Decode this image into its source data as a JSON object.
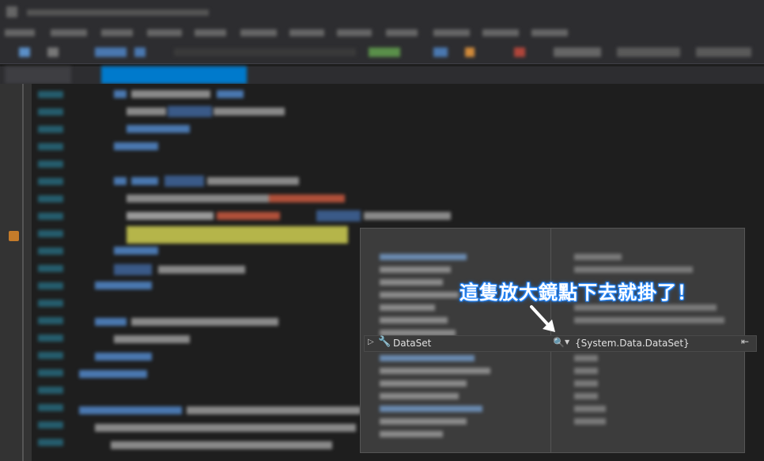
{
  "datatip": {
    "variable_name": "DataSet",
    "variable_value": "{System.Data.DataSet}",
    "wrench_icon": "wrench-icon",
    "magnifier_icon": "magnifier-icon",
    "expand_icon": "expand-triangle-icon",
    "pin_icon": "pin-icon"
  },
  "annotation": {
    "text": "這隻放大鏡點下去就掛了！",
    "color": "#ffffff",
    "glow": "#1e7cf0"
  },
  "colors": {
    "editor_bg": "#1e1e1e",
    "chrome_bg": "#2d2d30",
    "accent": "#007acc",
    "breakpoint": "#c47b2a",
    "highlight_line": "#b5b54a"
  }
}
